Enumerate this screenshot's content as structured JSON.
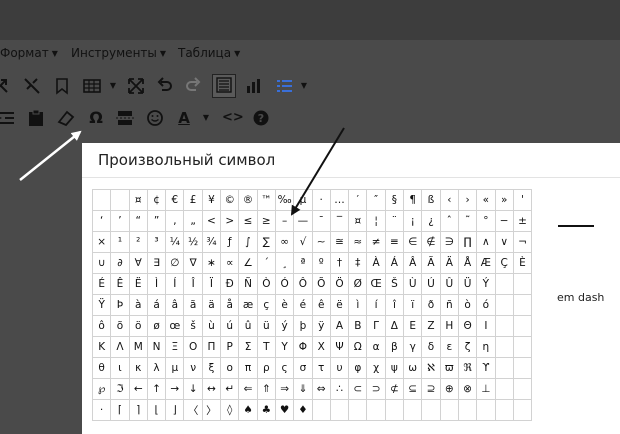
{
  "menubar": {
    "items": [
      {
        "label": "Формат"
      },
      {
        "label": "Инструменты"
      },
      {
        "label": "Таблица"
      }
    ]
  },
  "toolbar1": {
    "icons": [
      "link-icon",
      "unlink-icon",
      "bookmark-icon",
      "table-icon",
      "fullscreen-icon",
      "undo-icon",
      "redo-icon",
      "source-code-icon",
      "chart-icon",
      "list-icon"
    ]
  },
  "toolbar2": {
    "icons": [
      "indent-icon",
      "paste-icon",
      "eraser-icon",
      "omega-icon",
      "page-break-icon",
      "emoji-icon",
      "text-color-icon",
      "code-icon",
      "help-icon"
    ],
    "omega_glyph": "Ω",
    "color_glyph": "A"
  },
  "dialog": {
    "title": "Произвольный символ",
    "preview_name": "em dash",
    "symbols": [
      [
        "",
        "",
        "¤",
        "¢",
        "€",
        "£",
        "¥",
        "©",
        "®",
        "™",
        "‰",
        "µ",
        "·",
        "…",
        "′",
        "″",
        "§",
        "¶",
        "ß",
        "‹",
        "›",
        "«",
        "»",
        "'"
      ],
      [
        "‘",
        "’",
        "“",
        "”",
        "‚",
        "„",
        "<",
        ">",
        "≤",
        "≥",
        "–",
        "—",
        "¯",
        "‾",
        "¤",
        "¦",
        "¨",
        "¡",
        "¿",
        "ˆ",
        "˜",
        "°",
        "−",
        "±",
        "÷",
        "⁄"
      ],
      [
        "×",
        "¹",
        "²",
        "³",
        "¼",
        "½",
        "¾",
        "ƒ",
        "∫",
        "∑",
        "∞",
        "√",
        "∼",
        "≅",
        "≈",
        "≠",
        "≡",
        "∈",
        "∉",
        "∋",
        "∏",
        "∧",
        "∨",
        "¬"
      ],
      [
        "∪",
        "∂",
        "∀",
        "∃",
        "∅",
        "∇",
        "∗",
        "∝",
        "∠",
        "´",
        "¸",
        "ª",
        "º",
        "†",
        "‡",
        "À",
        "Á",
        "Â",
        "Ã",
        "Ä",
        "Å",
        "Æ",
        "Ç",
        "È"
      ],
      [
        "É",
        "Ê",
        "Ë",
        "Ì",
        "Í",
        "Î",
        "Ï",
        "Ð",
        "Ñ",
        "Ò",
        "Ó",
        "Ô",
        "Õ",
        "Ö",
        "Ø",
        "Œ",
        "Š",
        "Ù",
        "Ú",
        "Û",
        "Ü",
        "Ý"
      ],
      [
        "Ÿ",
        "Þ",
        "à",
        "á",
        "â",
        "ã",
        "ä",
        "å",
        "æ",
        "ç",
        "è",
        "é",
        "ê",
        "ë",
        "ì",
        "í",
        "î",
        "ï",
        "ð",
        "ñ",
        "ò",
        "ó"
      ],
      [
        "ô",
        "õ",
        "ö",
        "ø",
        "œ",
        "š",
        "ù",
        "ú",
        "û",
        "ü",
        "ý",
        "þ",
        "ÿ",
        "Α",
        "Β",
        "Γ",
        "Δ",
        "Ε",
        "Ζ",
        "Η",
        "Θ",
        "Ι"
      ],
      [
        "Κ",
        "Λ",
        "Μ",
        "Ν",
        "Ξ",
        "Ο",
        "Π",
        "Ρ",
        "Σ",
        "Τ",
        "Υ",
        "Φ",
        "Χ",
        "Ψ",
        "Ω",
        "α",
        "β",
        "γ",
        "δ",
        "ε",
        "ζ",
        "η"
      ],
      [
        "θ",
        "ι",
        "κ",
        "λ",
        "μ",
        "ν",
        "ξ",
        "ο",
        "π",
        "ρ",
        "ς",
        "σ",
        "τ",
        "υ",
        "φ",
        "χ",
        "ψ",
        "ω",
        "ℵ",
        "ϖ",
        "ℜ",
        "ϒ"
      ],
      [
        "℘",
        "ℑ",
        "←",
        "↑",
        "→",
        "↓",
        "↔",
        "↵",
        "⇐",
        "⇑",
        "⇒",
        "⇓",
        "⇔",
        "∴",
        "⊂",
        "⊃",
        "⊄",
        "⊆",
        "⊇",
        "⊕",
        "⊗",
        "⊥"
      ],
      [
        "⋅",
        "⌈",
        "⌉",
        "⌊",
        "⌋",
        "〈",
        "〉",
        "◊",
        "♠",
        "♣",
        "♥",
        "♦"
      ]
    ]
  }
}
